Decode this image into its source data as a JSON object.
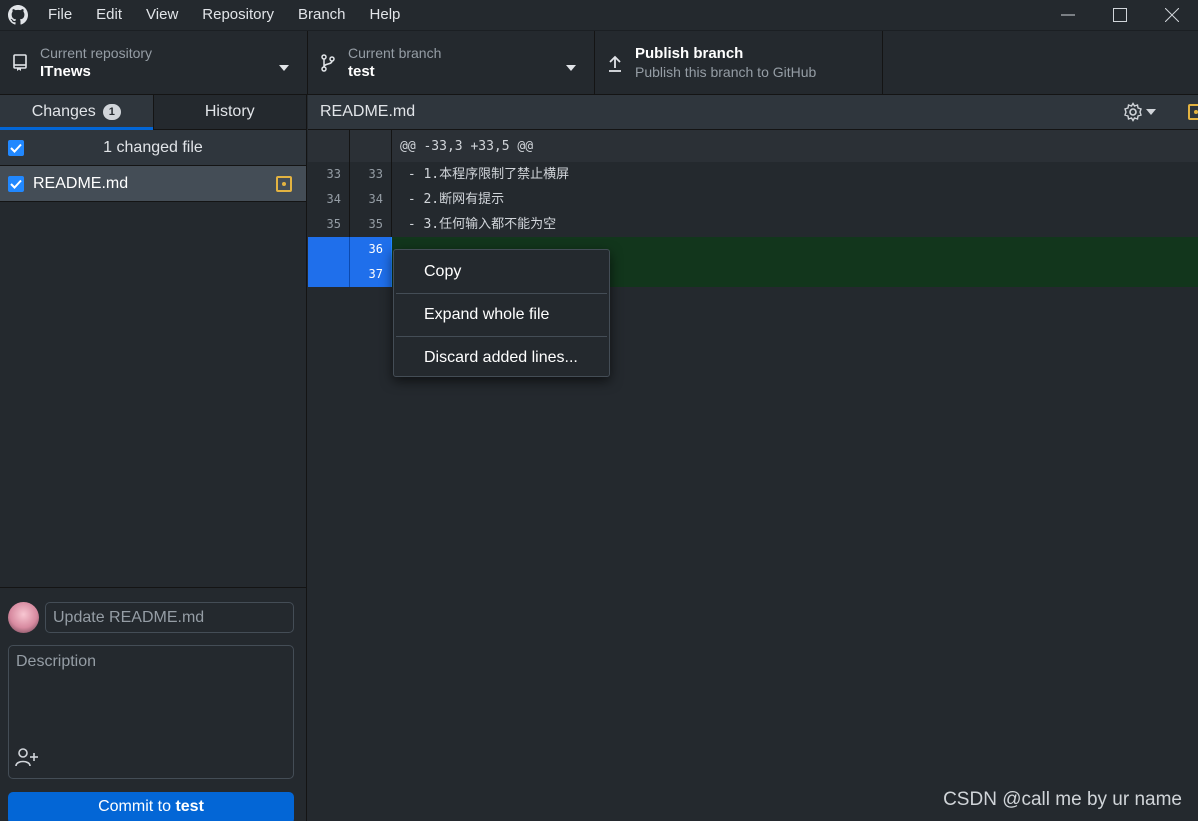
{
  "menu": [
    "File",
    "Edit",
    "View",
    "Repository",
    "Branch",
    "Help"
  ],
  "toolbar": {
    "repo_label": "Current repository",
    "repo_value": "ITnews",
    "branch_label": "Current branch",
    "branch_value": "test",
    "publish_title": "Publish branch",
    "publish_sub": "Publish this branch to GitHub"
  },
  "sidebar": {
    "tab_changes": "Changes",
    "changes_count": "1",
    "tab_history": "History",
    "changed_files_label": "1 changed file",
    "files": [
      {
        "name": "README.md",
        "status": "modified"
      }
    ]
  },
  "commit": {
    "summary_placeholder": "Update README.md",
    "description_placeholder": "Description",
    "button_prefix": "Commit to ",
    "button_branch": "test"
  },
  "diff": {
    "file": "README.md",
    "hunk_header": "@@ -33,3 +33,5 @@",
    "lines": [
      {
        "old": "33",
        "new": "33",
        "text": " - 1.本程序限制了禁止横屏",
        "type": "context"
      },
      {
        "old": "34",
        "new": "34",
        "text": " - 2.断网有提示",
        "type": "context"
      },
      {
        "old": "35",
        "new": "35",
        "text": " - 3.任何输入都不能为空",
        "type": "context"
      },
      {
        "old": "",
        "new": "36",
        "text": "",
        "type": "added"
      },
      {
        "old": "",
        "new": "37",
        "text": "",
        "type": "added"
      }
    ]
  },
  "context_menu": {
    "items": [
      "Copy",
      "Expand whole file",
      "Discard added lines..."
    ]
  },
  "watermark": "CSDN @call me by ur name",
  "colors": {
    "accent": "#0366d6",
    "modified": "#e3b341",
    "added_bg": "#12361c"
  }
}
